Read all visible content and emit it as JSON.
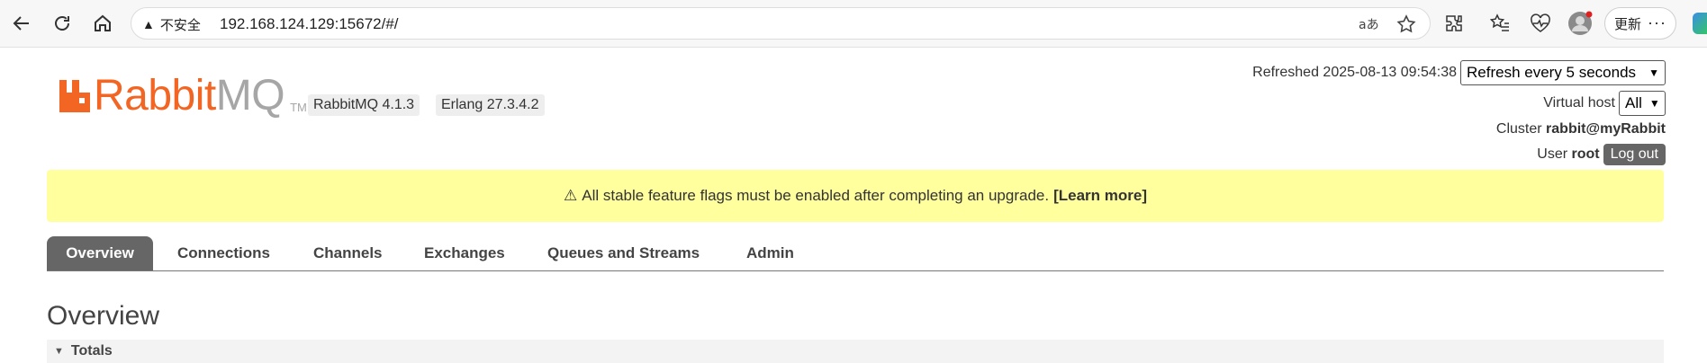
{
  "browser": {
    "security_label": "不安全",
    "url": "192.168.124.129:15672/#/",
    "update_label": "更新",
    "more_label": "···"
  },
  "header": {
    "logo_rabbit": "Rabbit",
    "logo_mq": "MQ",
    "logo_tm": "TM",
    "rabbitmq_version": "RabbitMQ 4.1.3",
    "erlang_version": "Erlang 27.3.4.2",
    "refreshed_label": "Refreshed 2025-08-13 09:54:38",
    "refresh_select_value": "Refresh every 5 seconds",
    "virtual_host_label": "Virtual host",
    "virtual_host_value": "All",
    "cluster_label": "Cluster",
    "cluster_value": "rabbit@myRabbit",
    "user_label": "User",
    "user_value": "root",
    "logout_label": "Log out"
  },
  "alert": {
    "icon": "⚠",
    "message": "All stable feature flags must be enabled after completing an upgrade.",
    "link": "[Learn more]"
  },
  "tabs": [
    {
      "label": "Overview",
      "active": true
    },
    {
      "label": "Connections",
      "active": false
    },
    {
      "label": "Channels",
      "active": false
    },
    {
      "label": "Exchanges",
      "active": false
    },
    {
      "label": "Queues and Streams",
      "active": false
    },
    {
      "label": "Admin",
      "active": false
    }
  ],
  "main": {
    "title": "Overview",
    "totals_section": "Totals"
  },
  "colors": {
    "brand": "#f26522",
    "alert_bg": "#ffff9e",
    "active_tab": "#666666"
  }
}
